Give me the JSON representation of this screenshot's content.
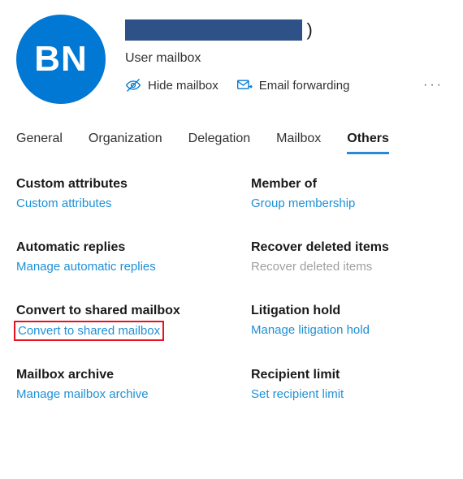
{
  "header": {
    "avatar_initials": "BN",
    "name_suffix": ")",
    "subtitle": "User mailbox",
    "hide_label": "Hide mailbox",
    "forward_label": "Email forwarding"
  },
  "tabs": {
    "general": "General",
    "organization": "Organization",
    "delegation": "Delegation",
    "mailbox": "Mailbox",
    "others": "Others"
  },
  "sections": {
    "custom_attributes": {
      "title": "Custom attributes",
      "link": "Custom attributes"
    },
    "member_of": {
      "title": "Member of",
      "link": "Group membership"
    },
    "automatic_replies": {
      "title": "Automatic replies",
      "link": "Manage automatic replies"
    },
    "recover_deleted": {
      "title": "Recover deleted items",
      "link": "Recover deleted items"
    },
    "convert_shared": {
      "title": "Convert to shared mailbox",
      "link": "Convert to shared mailbox"
    },
    "litigation_hold": {
      "title": "Litigation hold",
      "link": "Manage litigation hold"
    },
    "mailbox_archive": {
      "title": "Mailbox archive",
      "link": "Manage mailbox archive"
    },
    "recipient_limit": {
      "title": "Recipient limit",
      "link": "Set recipient limit"
    }
  }
}
